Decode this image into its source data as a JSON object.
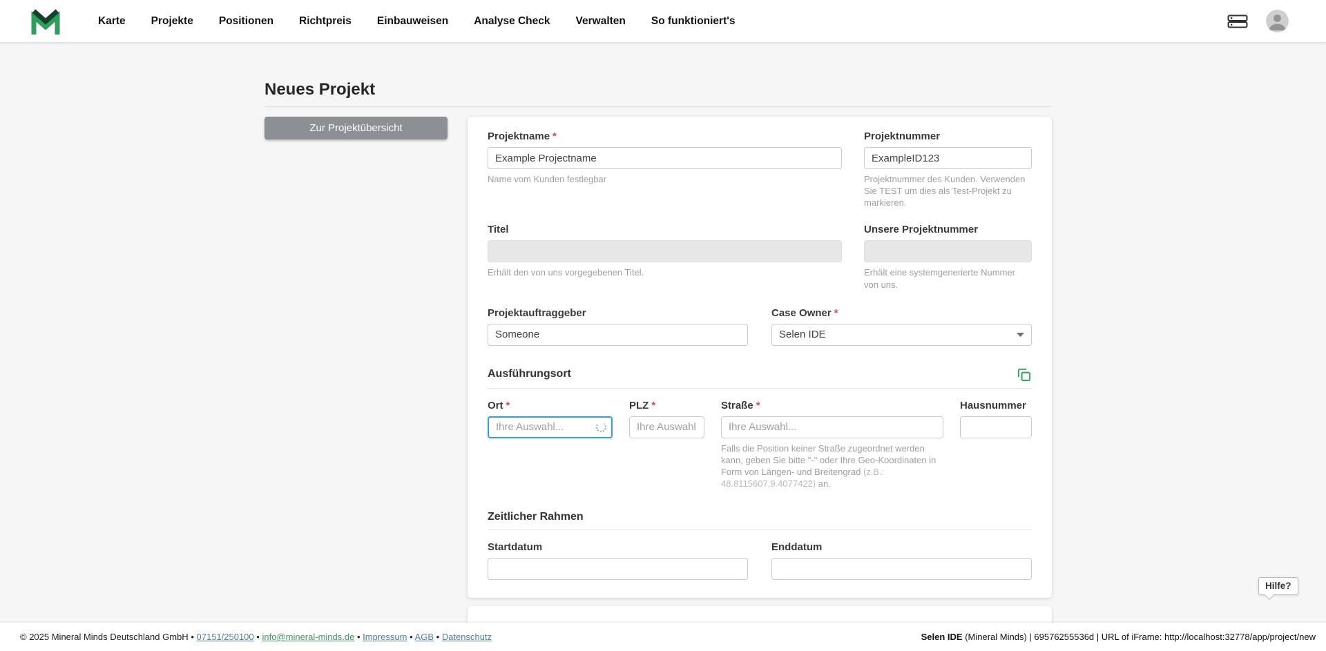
{
  "brand": {
    "green": "#2e9e5b",
    "dark": "#17402b"
  },
  "nav": {
    "items": [
      "Karte",
      "Projekte",
      "Positionen",
      "Richtpreis",
      "Einbauweisen",
      "Analyse Check",
      "Verwalten",
      "So funktioniert's"
    ]
  },
  "page": {
    "title": "Neues Projekt",
    "back_button_label": "Zur Projektübersicht"
  },
  "form": {
    "required_marker": "*",
    "projektname": {
      "label": "Projektname",
      "value": "Example Projectname",
      "helper": "Name vom Kunden festlegbar"
    },
    "projektnummer": {
      "label": "Projektnummer",
      "value": "ExampleID123",
      "helper": "Projektnummer des Kunden. Verwenden Sie TEST um dies als Test-Projekt zu markieren."
    },
    "titel": {
      "label": "Titel",
      "value": "",
      "helper": "Erhält den von uns vorgegebenen Titel."
    },
    "unsere_projektnummer": {
      "label": "Unsere Projektnummer",
      "value": "",
      "helper": "Erhält eine systemgenerierte Nummer von uns."
    },
    "projektauftraggeber": {
      "label": "Projektauftraggeber",
      "value": "Someone"
    },
    "case_owner": {
      "label": "Case Owner",
      "value": "Selen IDE"
    },
    "sections": {
      "ausfuehrungsort": "Ausführungsort",
      "zeitlicher_rahmen": "Zeitlicher Rahmen"
    },
    "ort": {
      "label": "Ort",
      "placeholder": "Ihre Auswahl..."
    },
    "plz": {
      "label": "PLZ",
      "placeholder": "Ihre Auswahl."
    },
    "strasse": {
      "label": "Straße",
      "placeholder": "Ihre Auswahl...",
      "helper_main": "Falls die Position keiner Straße zugeordnet werden kann, geben Sie bitte \"-\" oder Ihre Geo-Koordinaten in Form von Längen- und Breitengrad ",
      "helper_example": "(z.B.: 48.8115607,9.4077422)",
      "helper_suffix": " an."
    },
    "hausnummer": {
      "label": "Hausnummer"
    },
    "startdatum": {
      "label": "Startdatum"
    },
    "enddatum": {
      "label": "Enddatum"
    }
  },
  "help": {
    "label": "Hilfe?"
  },
  "footer": {
    "copyright": "© 2025 Mineral Minds Deutschland GmbH",
    "separator": "•",
    "phone": "07151/250100",
    "email": "info@mineral-minds.de",
    "impressum": "Impressum",
    "agb": "AGB",
    "datenschutz": "Datenschutz",
    "session_user": "Selen IDE",
    "session_rest": " (Mineral Minds) | 69576255536d | URL of iFrame: http://localhost:32778/app/project/new"
  }
}
